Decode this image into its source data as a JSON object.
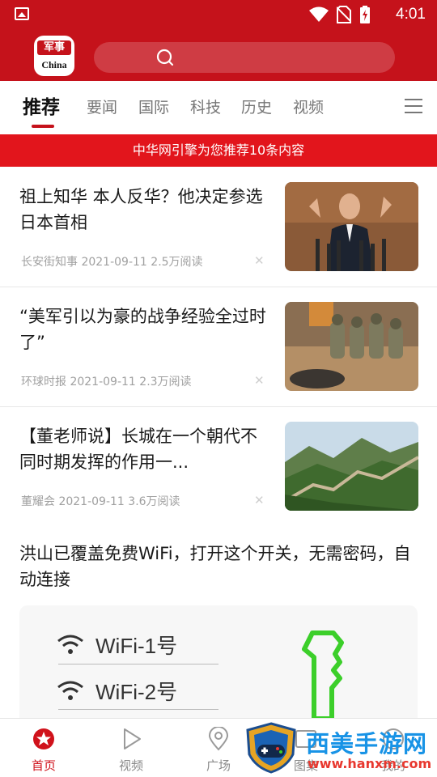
{
  "status_bar": {
    "time": "4:01"
  },
  "header": {
    "logo_top": "军事",
    "logo_bottom": "China"
  },
  "tabs": [
    {
      "label": "推荐",
      "active": true
    },
    {
      "label": "要闻"
    },
    {
      "label": "国际"
    },
    {
      "label": "科技"
    },
    {
      "label": "历史"
    },
    {
      "label": "视频"
    }
  ],
  "banner": {
    "text": "中华网引擎为您推荐10条内容"
  },
  "articles": [
    {
      "title": "祖上知华 本人反华？他决定参选日本首相",
      "source": "长安街知事",
      "date": "2021-09-11",
      "reads": "2.5万阅读",
      "image": "man-speaking-at-microphones"
    },
    {
      "title": "“美军引以为豪的战争经验全过时了”",
      "source": "环球时报",
      "date": "2021-09-11",
      "reads": "2.3万阅读",
      "image": "soldiers-in-camouflage"
    },
    {
      "title": "【董老师说】长城在一个朝代不同时期发挥的作用一...",
      "source": "董耀会",
      "date": "2021-09-11",
      "reads": "3.6万阅读",
      "image": "great-wall-mountains"
    }
  ],
  "ad_article": {
    "title": "洪山已覆盖免费WiFi，打开这个开关，无需密码，自动连接",
    "wifi_1": "WiFi-1号",
    "wifi_2": "WiFi-2号"
  },
  "bottom_nav": [
    {
      "label": "首页",
      "active": true
    },
    {
      "label": "视频"
    },
    {
      "label": "广场"
    },
    {
      "label": "图集"
    },
    {
      "label": "我的"
    }
  ],
  "watermark": {
    "title": "西美手游网",
    "url": "www.hanxm.com"
  },
  "colors": {
    "brand_red": "#c5121b",
    "banner_red": "#e2151c",
    "active_tab_accent": "#c5121b",
    "watermark_blue": "#1893e6"
  }
}
